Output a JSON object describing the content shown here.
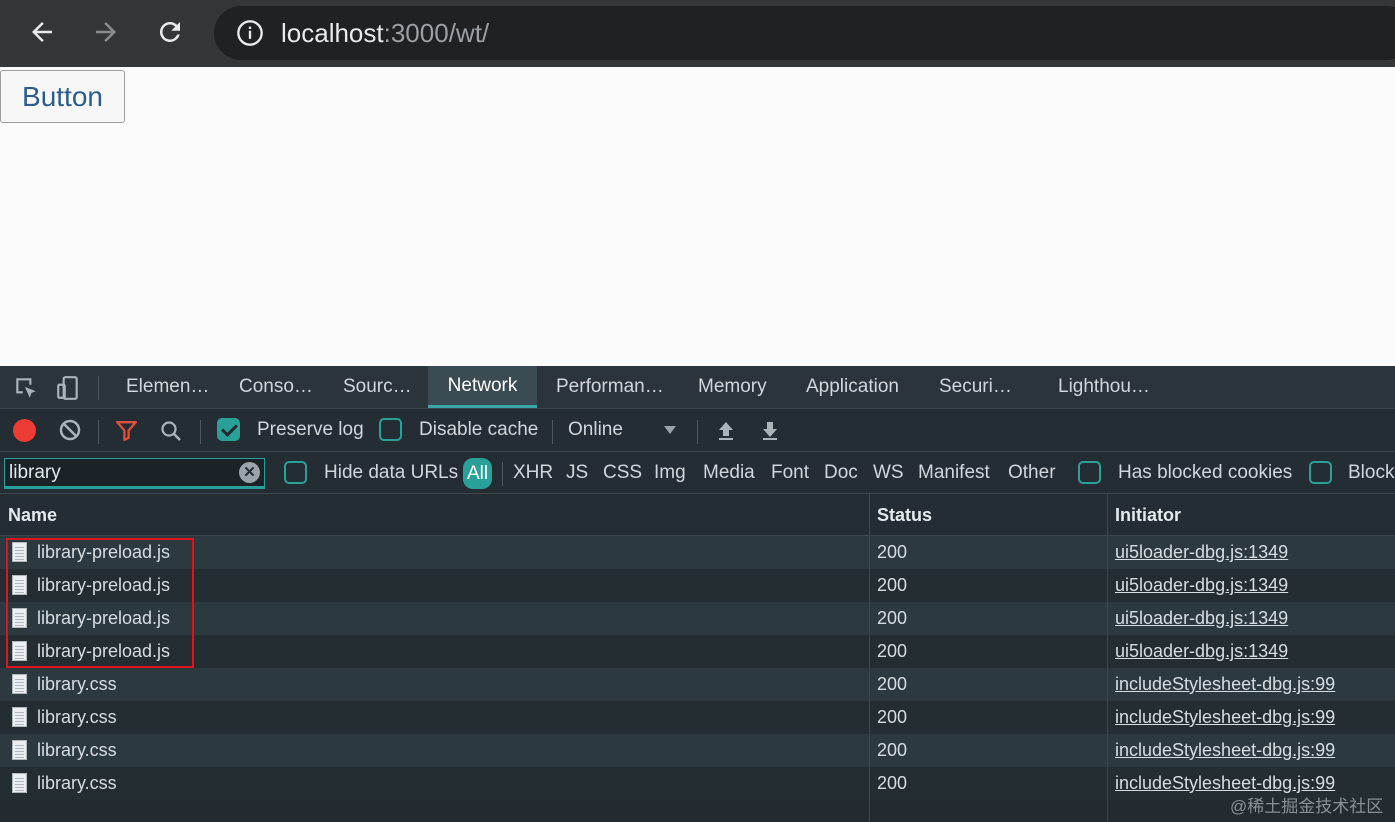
{
  "browser": {
    "url_host": "localhost",
    "url_rest": ":3000/wt/"
  },
  "page": {
    "button_label": "Button"
  },
  "devtools": {
    "tabs": [
      {
        "label": "Elemen…"
      },
      {
        "label": "Conso…"
      },
      {
        "label": "Sourc…"
      },
      {
        "label": "Network"
      },
      {
        "label": "Performan…"
      },
      {
        "label": "Memory"
      },
      {
        "label": "Application"
      },
      {
        "label": "Securi…"
      },
      {
        "label": "Lighthou…"
      }
    ],
    "active_tab": "Network",
    "toolbar": {
      "preserve_log_label": "Preserve log",
      "preserve_log_checked": true,
      "disable_cache_label": "Disable cache",
      "disable_cache_checked": false,
      "throttling": "Online"
    },
    "filter": {
      "value": "library",
      "hide_data_urls_label": "Hide data URLs",
      "types": [
        "All",
        "XHR",
        "JS",
        "CSS",
        "Img",
        "Media",
        "Font",
        "Doc",
        "WS",
        "Manifest",
        "Other"
      ],
      "active_type": "All",
      "has_blocked_cookies_label": "Has blocked cookies",
      "blocked_requests_label": "Block"
    },
    "table": {
      "headers": {
        "name": "Name",
        "status": "Status",
        "initiator": "Initiator"
      },
      "rows": [
        {
          "name": "library-preload.js",
          "status": "200",
          "initiator": "ui5loader-dbg.js:1349"
        },
        {
          "name": "library-preload.js",
          "status": "200",
          "initiator": "ui5loader-dbg.js:1349"
        },
        {
          "name": "library-preload.js",
          "status": "200",
          "initiator": "ui5loader-dbg.js:1349"
        },
        {
          "name": "library-preload.js",
          "status": "200",
          "initiator": "ui5loader-dbg.js:1349"
        },
        {
          "name": "library.css",
          "status": "200",
          "initiator": "includeStylesheet-dbg.js:99"
        },
        {
          "name": "library.css",
          "status": "200",
          "initiator": "includeStylesheet-dbg.js:99"
        },
        {
          "name": "library.css",
          "status": "200",
          "initiator": "includeStylesheet-dbg.js:99"
        },
        {
          "name": "library.css",
          "status": "200",
          "initiator": "includeStylesheet-dbg.js:99"
        }
      ]
    }
  },
  "watermark": "@稀土掘金技术社区",
  "colors": {
    "accent": "#2aa198",
    "record": "#ef3b36",
    "filter_icon": "#e0503c",
    "highlight_box": "#e0141e"
  },
  "icons": [
    "back-arrow-icon",
    "forward-arrow-icon",
    "reload-icon",
    "info-icon",
    "inspect-element-icon",
    "device-toolbar-icon",
    "record-icon",
    "clear-icon",
    "filter-icon",
    "search-icon",
    "dropdown-icon",
    "upload-icon",
    "download-icon",
    "file-icon"
  ]
}
